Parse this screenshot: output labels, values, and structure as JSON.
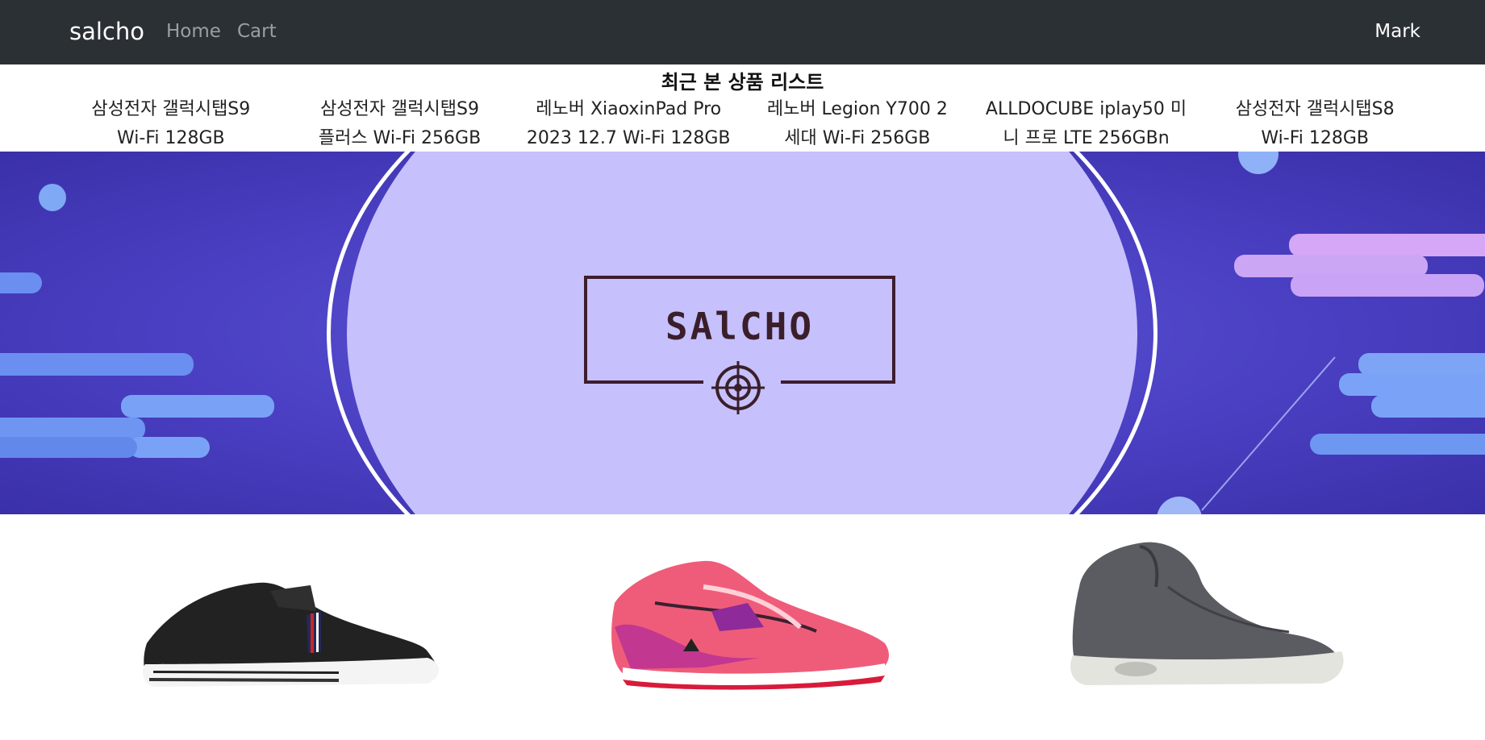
{
  "navbar": {
    "brand": "salcho",
    "links": [
      "Home",
      "Cart"
    ],
    "user": "Mark"
  },
  "recent": {
    "title": "최근 본 상품 리스트",
    "items": [
      {
        "line1": "삼성전자 갤럭시탭S9",
        "line2": "Wi-Fi 128GB"
      },
      {
        "line1": "삼성전자 갤럭시탭S9",
        "line2": "플러스 Wi-Fi 256GB"
      },
      {
        "line1": "레노버 XiaoxinPad Pro",
        "line2": "2023 12.7 Wi-Fi 128GB"
      },
      {
        "line1": "레노버 Legion Y700 2",
        "line2": "세대 Wi-Fi 256GB"
      },
      {
        "line1": "ALLDOCUBE iplay50 미",
        "line2": "니 프로 LTE 256GBn"
      },
      {
        "line1": "삼성전자 갤럭시탭S8",
        "line2": "Wi-Fi 128GB"
      }
    ]
  },
  "banner": {
    "logo_text": "SAlCHO"
  },
  "products": [
    {
      "icon": "black-sneaker-image"
    },
    {
      "icon": "pink-running-shoe-image"
    },
    {
      "icon": "gray-high-top-sneaker-image"
    }
  ]
}
